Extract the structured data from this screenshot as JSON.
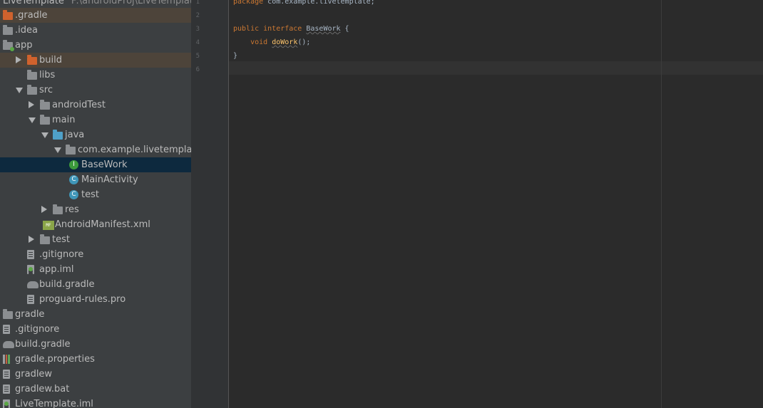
{
  "project_header": {
    "name": "LiveTemplate",
    "path": "F:\\androidProj\\LiveTemplate"
  },
  "tree": [
    {
      "label": ".gradle",
      "icon": "folder-orange-icon",
      "indent": 0,
      "arrow": "none",
      "style": "vcs-excluded"
    },
    {
      "label": ".idea",
      "icon": "folder-icon",
      "indent": 0,
      "arrow": "none"
    },
    {
      "label": "app",
      "icon": "module-folder-icon",
      "indent": 0,
      "arrow": "none"
    },
    {
      "label": "build",
      "icon": "folder-orange-icon",
      "indent": 1,
      "arrow": "right",
      "style": "vcs-excluded"
    },
    {
      "label": "libs",
      "icon": "folder-icon",
      "indent": 1,
      "arrow": "none"
    },
    {
      "label": "src",
      "icon": "folder-icon",
      "indent": 1,
      "arrow": "down"
    },
    {
      "label": "androidTest",
      "icon": "folder-icon",
      "indent": 2,
      "arrow": "right"
    },
    {
      "label": "main",
      "icon": "folder-icon",
      "indent": 2,
      "arrow": "down"
    },
    {
      "label": "java",
      "icon": "folder-blue-icon",
      "indent": 3,
      "arrow": "down"
    },
    {
      "label": "com.example.livetemplate",
      "icon": "package-icon",
      "indent": 4,
      "arrow": "down"
    },
    {
      "label": "BaseWork",
      "icon": "interface-icon",
      "indent": 5,
      "arrow": "none",
      "style": "selected"
    },
    {
      "label": "MainActivity",
      "icon": "class-icon",
      "indent": 5,
      "arrow": "none"
    },
    {
      "label": "test",
      "icon": "class-icon",
      "indent": 5,
      "arrow": "none"
    },
    {
      "label": "res",
      "icon": "res-folder-icon",
      "indent": 3,
      "arrow": "right"
    },
    {
      "label": "AndroidManifest.xml",
      "icon": "manifest-icon",
      "indent": 3,
      "arrow": "none"
    },
    {
      "label": "test",
      "icon": "folder-icon",
      "indent": 2,
      "arrow": "right"
    },
    {
      "label": ".gitignore",
      "icon": "text-file-icon",
      "indent": 1,
      "arrow": "none"
    },
    {
      "label": "app.iml",
      "icon": "iml-file-icon",
      "indent": 1,
      "arrow": "none"
    },
    {
      "label": "build.gradle",
      "icon": "gradle-icon",
      "indent": 1,
      "arrow": "none"
    },
    {
      "label": "proguard-rules.pro",
      "icon": "text-file-icon",
      "indent": 1,
      "arrow": "none"
    },
    {
      "label": "gradle",
      "icon": "folder-icon",
      "indent": 0,
      "arrow": "none"
    },
    {
      "label": ".gitignore",
      "icon": "text-file-icon",
      "indent": 0,
      "arrow": "none"
    },
    {
      "label": "build.gradle",
      "icon": "gradle-icon",
      "indent": 0,
      "arrow": "none"
    },
    {
      "label": "gradle.properties",
      "icon": "properties-icon",
      "indent": 0,
      "arrow": "none"
    },
    {
      "label": "gradlew",
      "icon": "text-file-icon",
      "indent": 0,
      "arrow": "none"
    },
    {
      "label": "gradlew.bat",
      "icon": "text-file-icon",
      "indent": 0,
      "arrow": "none"
    },
    {
      "label": "LiveTemplate.iml",
      "icon": "iml-file-icon",
      "indent": 0,
      "arrow": "none"
    }
  ],
  "editor": {
    "line_numbers": [
      "1",
      "2",
      "3",
      "4",
      "5",
      "6"
    ],
    "lines": [
      {
        "kw": "package",
        "rest": " com.example.livetemplate;"
      },
      {
        "kw": "",
        "rest": ""
      },
      {
        "kw": "public interface",
        "type": "BaseWork",
        "rest": " {"
      },
      {
        "indent": "    ",
        "kw": "void",
        "fn": "doWork",
        "rest": "();"
      },
      {
        "kw": "",
        "rest": "}"
      },
      {
        "kw": "",
        "rest": ""
      }
    ]
  },
  "colors": {
    "tree_bg": "#3c3f41",
    "editor_bg": "#2b2b2b",
    "keyword": "#cc7832",
    "selected": "#0d293e"
  }
}
